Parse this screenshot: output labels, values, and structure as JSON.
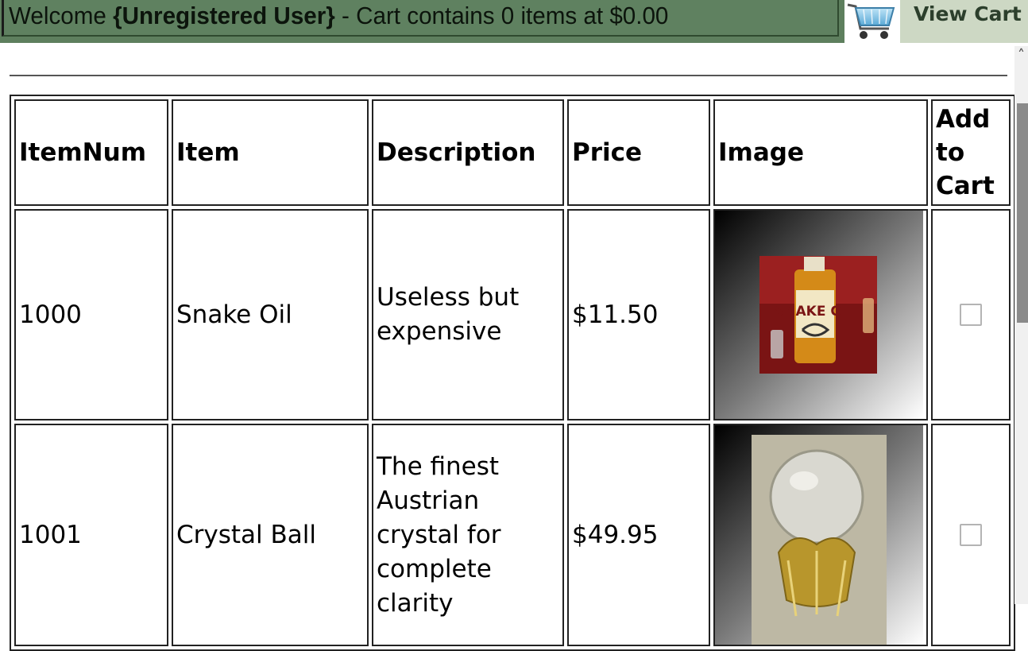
{
  "header": {
    "welcome_prefix": "Welcome ",
    "user_name": "{Unregistered User}",
    "cart_summary": " - Cart contains 0 items at $0.00",
    "view_cart_label": "View Cart"
  },
  "table": {
    "columns": [
      "ItemNum",
      "Item",
      "Description",
      "Price",
      "Image",
      "Add to Cart"
    ],
    "rows": [
      {
        "item_num": "1000",
        "item": "Snake Oil",
        "description": "Useless but expensive",
        "price": "$11.50",
        "image_label": "SNAKE OIL",
        "checked": false
      },
      {
        "item_num": "1001",
        "item": "Crystal Ball",
        "description": "The finest Austrian crystal for complete clarity",
        "price": "$49.95",
        "checked": false
      }
    ]
  },
  "colors": {
    "header_bg": "#5e7f5e",
    "view_cart_bg": "#cdd8c4"
  }
}
